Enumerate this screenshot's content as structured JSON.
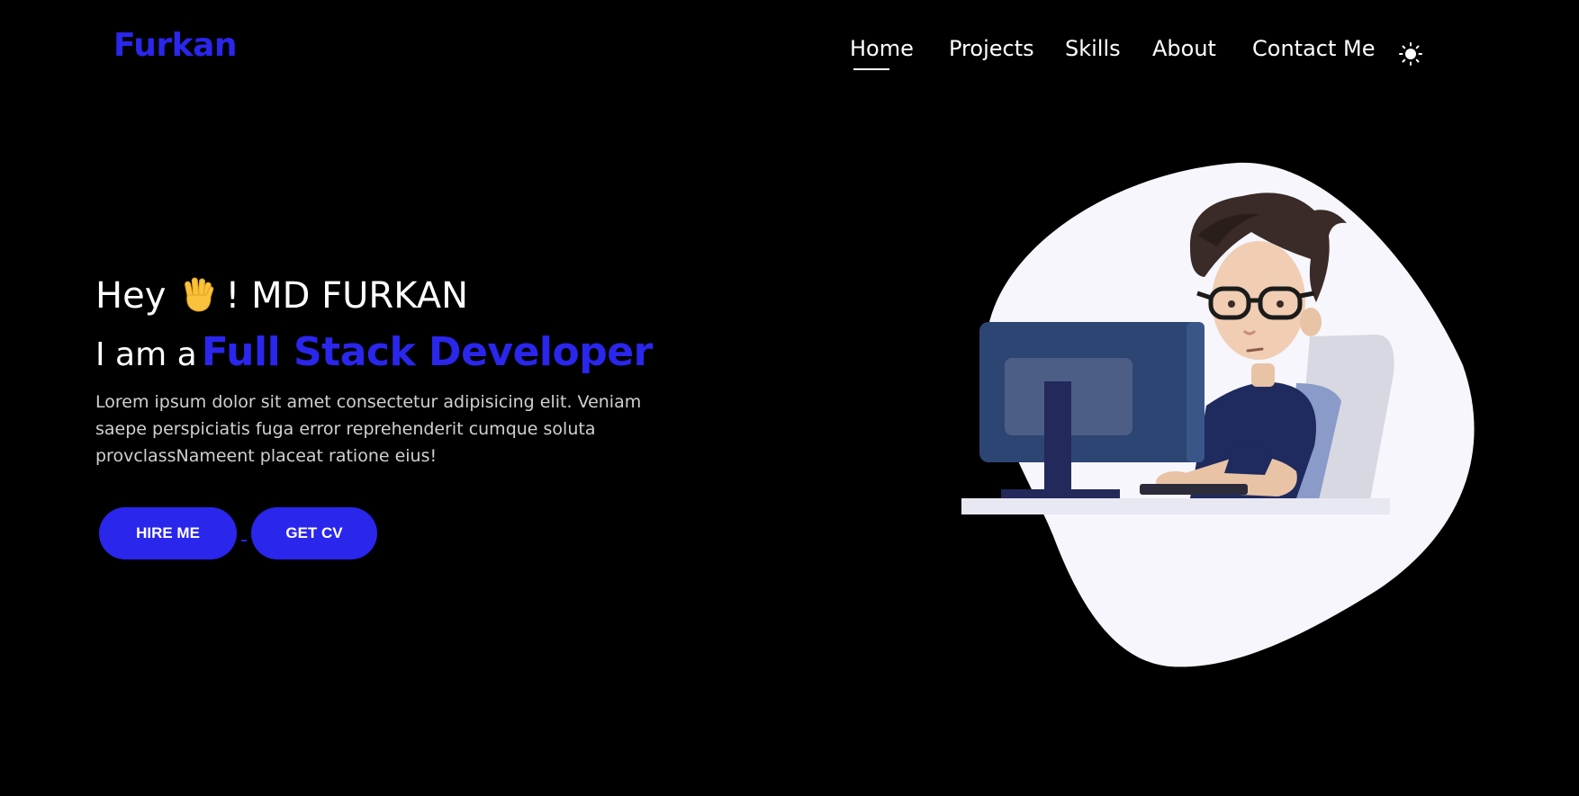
{
  "logo": "Furkan",
  "nav": {
    "items": [
      {
        "label": "Home",
        "active": true
      },
      {
        "label": "Projects",
        "active": false
      },
      {
        "label": "Skills",
        "active": false
      },
      {
        "label": "About",
        "active": false
      },
      {
        "label": "Contact Me",
        "active": false
      }
    ],
    "theme_icon": "sun-icon"
  },
  "hero": {
    "greeting": "Hey",
    "greeting_icon": "waving-hand-icon",
    "name": "! MD FURKAN",
    "role_prefix": "I am a",
    "role": "Full Stack Developer",
    "description": "Lorem ipsum dolor sit amet consectetur adipisicing elit. Veniam saepe perspiciatis fuga error reprehenderit cumque soluta provclassNameent placeat ratione eius!",
    "buttons": {
      "hire": "HIRE ME",
      "cv": "GET CV"
    },
    "illustration": "developer-at-computer-illustration"
  },
  "colors": {
    "background": "#000000",
    "accent": "#2a26ec",
    "text": "#ffffff"
  }
}
